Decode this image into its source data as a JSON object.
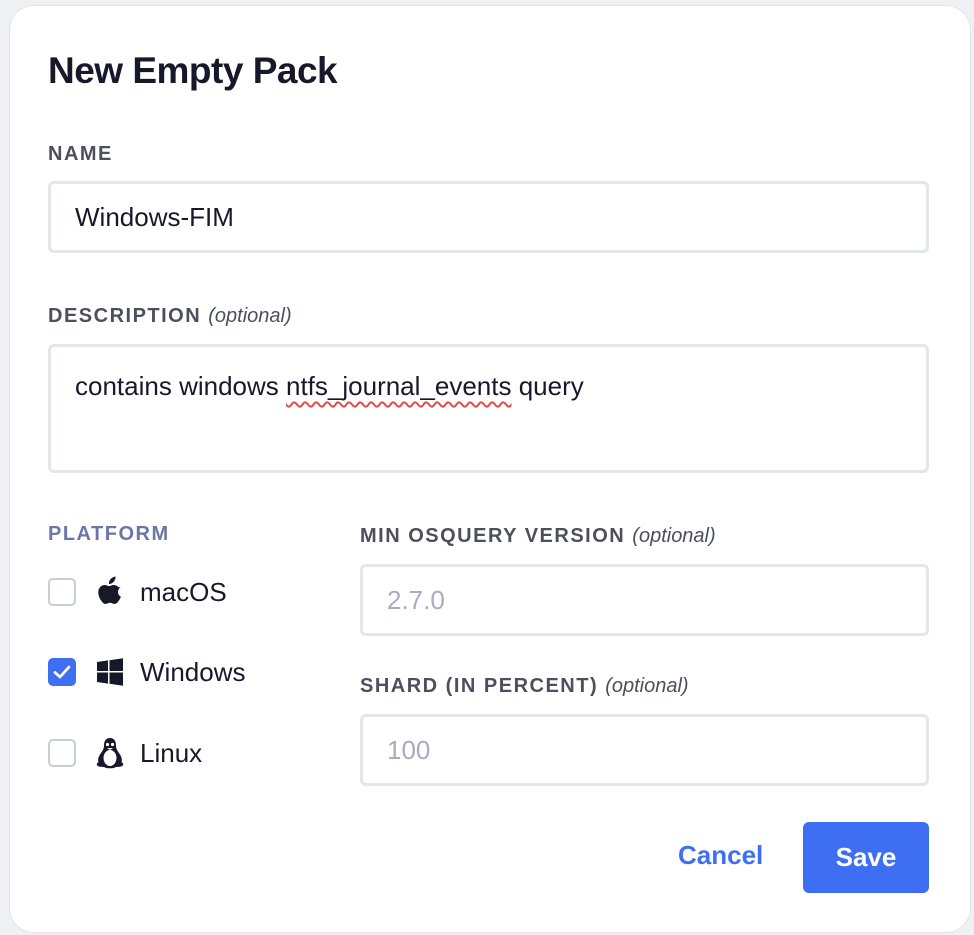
{
  "modal": {
    "title": "New Empty Pack"
  },
  "name": {
    "label": "NAME",
    "value": "Windows-FIM"
  },
  "description": {
    "label": "DESCRIPTION",
    "optional": "(optional)",
    "value_before": "contains windows ",
    "value_misspelled": "ntfs_journal_events",
    "value_after": " query"
  },
  "platform": {
    "label": "PLATFORM",
    "options": [
      {
        "label": "macOS",
        "checked": false,
        "icon": "apple-icon"
      },
      {
        "label": "Windows",
        "checked": true,
        "icon": "windows-icon"
      },
      {
        "label": "Linux",
        "checked": false,
        "icon": "linux-icon"
      }
    ]
  },
  "min_osquery_version": {
    "label": "MIN OSQUERY VERSION",
    "optional": "(optional)",
    "placeholder": "2.7.0"
  },
  "shard": {
    "label": "SHARD (IN PERCENT)",
    "optional": "(optional)",
    "placeholder": "100"
  },
  "actions": {
    "cancel_label": "Cancel",
    "save_label": "Save"
  },
  "colors": {
    "accent": "#3e6ef2",
    "title": "#17192b",
    "platform_label": "#6a77a6",
    "placeholder": "#a7acc3"
  }
}
